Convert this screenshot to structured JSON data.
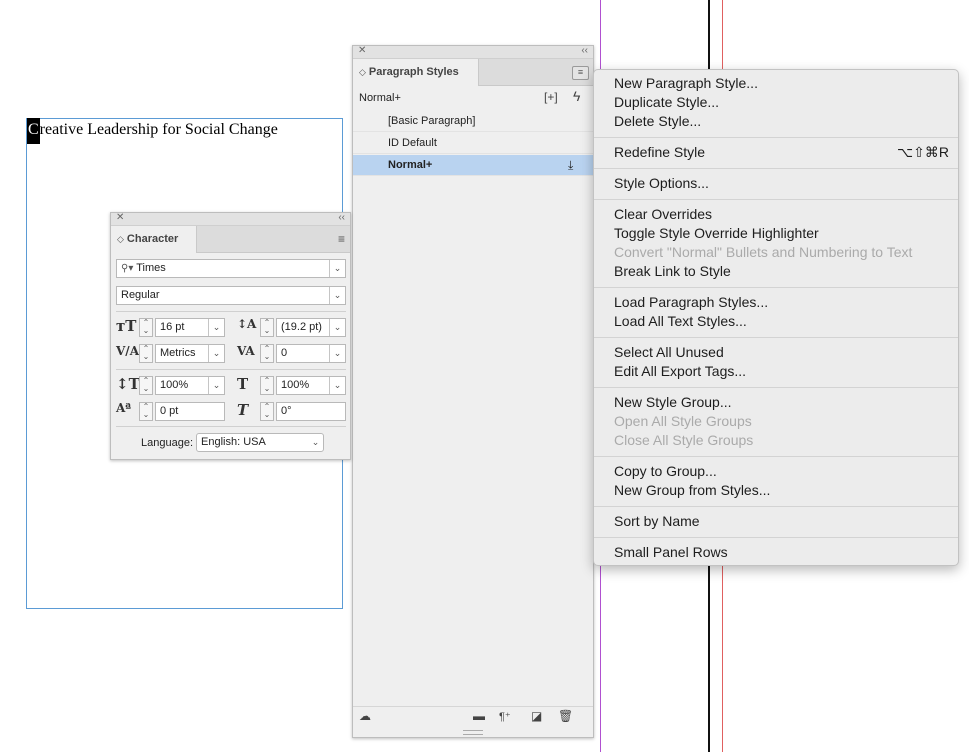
{
  "document": {
    "first_letter": "C",
    "rest_text": "reative Leadership for Social Change"
  },
  "paragraph_panel": {
    "tab_title": "Paragraph Styles",
    "current_style": "Normal+",
    "styles": [
      {
        "label": "[Basic Paragraph]"
      },
      {
        "label": "ID Default"
      },
      {
        "label": "Normal+"
      }
    ],
    "footer_icons": [
      "cloud-library-icon",
      "folder-icon",
      "clear-overrides-icon",
      "new-style-icon",
      "trash-icon"
    ]
  },
  "character_panel": {
    "tab_title": "Character",
    "font_family": "Times",
    "font_style": "Regular",
    "font_size": "16 pt",
    "leading": "(19.2 pt)",
    "kerning": "Metrics",
    "tracking": "0",
    "vertical_scale": "100%",
    "horizontal_scale": "100%",
    "baseline_shift": "0 pt",
    "skew": "0°",
    "language_label": "Language:",
    "language": "English: USA"
  },
  "flyout_menu": {
    "groups": [
      [
        {
          "label": "New Paragraph Style..."
        },
        {
          "label": "Duplicate Style..."
        },
        {
          "label": "Delete Style..."
        }
      ],
      [
        {
          "label": "Redefine Style",
          "shortcut": "⌥⇧⌘R"
        }
      ],
      [
        {
          "label": "Style Options..."
        }
      ],
      [
        {
          "label": "Clear Overrides"
        },
        {
          "label": "Toggle Style Override Highlighter"
        },
        {
          "label": "Convert \"Normal\" Bullets and Numbering to Text",
          "disabled": true
        },
        {
          "label": "Break Link to Style"
        }
      ],
      [
        {
          "label": "Load Paragraph Styles..."
        },
        {
          "label": "Load All Text Styles..."
        }
      ],
      [
        {
          "label": "Select All Unused"
        },
        {
          "label": "Edit All Export Tags..."
        }
      ],
      [
        {
          "label": "New Style Group..."
        },
        {
          "label": "Open All Style Groups",
          "disabled": true
        },
        {
          "label": "Close All Style Groups",
          "disabled": true
        }
      ],
      [
        {
          "label": "Copy to Group..."
        },
        {
          "label": "New Group from Styles..."
        }
      ],
      [
        {
          "label": "Sort by Name"
        }
      ],
      [
        {
          "label": "Small Panel Rows"
        }
      ]
    ]
  },
  "colors": {
    "frame_border": "#5b9bd5",
    "selected_row": "#b9d3f0",
    "guide_purple": "#a020f0",
    "guide_red": "#e05050"
  }
}
